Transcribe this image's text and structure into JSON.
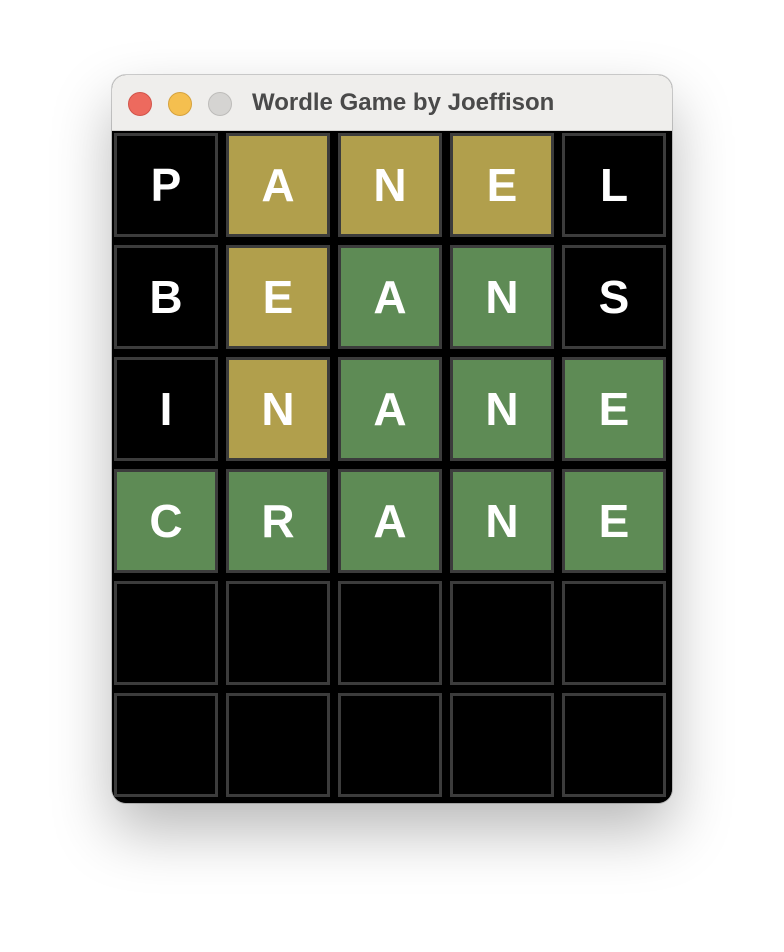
{
  "window": {
    "title": "Wordle Game by Joeffison"
  },
  "colors": {
    "present": "#b19f4c",
    "correct": "#5e8b55",
    "absent": "#000000",
    "tile_border": "#3c3c3c"
  },
  "board": {
    "rows": [
      {
        "tiles": [
          {
            "letter": "P",
            "state": "absent"
          },
          {
            "letter": "A",
            "state": "present"
          },
          {
            "letter": "N",
            "state": "present"
          },
          {
            "letter": "E",
            "state": "present"
          },
          {
            "letter": "L",
            "state": "absent"
          }
        ]
      },
      {
        "tiles": [
          {
            "letter": "B",
            "state": "absent"
          },
          {
            "letter": "E",
            "state": "present"
          },
          {
            "letter": "A",
            "state": "correct"
          },
          {
            "letter": "N",
            "state": "correct"
          },
          {
            "letter": "S",
            "state": "absent"
          }
        ]
      },
      {
        "tiles": [
          {
            "letter": "I",
            "state": "absent"
          },
          {
            "letter": "N",
            "state": "present"
          },
          {
            "letter": "A",
            "state": "correct"
          },
          {
            "letter": "N",
            "state": "correct"
          },
          {
            "letter": "E",
            "state": "correct"
          }
        ]
      },
      {
        "tiles": [
          {
            "letter": "C",
            "state": "correct"
          },
          {
            "letter": "R",
            "state": "correct"
          },
          {
            "letter": "A",
            "state": "correct"
          },
          {
            "letter": "N",
            "state": "correct"
          },
          {
            "letter": "E",
            "state": "correct"
          }
        ]
      },
      {
        "tiles": [
          {
            "letter": "",
            "state": "empty"
          },
          {
            "letter": "",
            "state": "empty"
          },
          {
            "letter": "",
            "state": "empty"
          },
          {
            "letter": "",
            "state": "empty"
          },
          {
            "letter": "",
            "state": "empty"
          }
        ]
      },
      {
        "tiles": [
          {
            "letter": "",
            "state": "empty"
          },
          {
            "letter": "",
            "state": "empty"
          },
          {
            "letter": "",
            "state": "empty"
          },
          {
            "letter": "",
            "state": "empty"
          },
          {
            "letter": "",
            "state": "empty"
          }
        ]
      }
    ]
  }
}
